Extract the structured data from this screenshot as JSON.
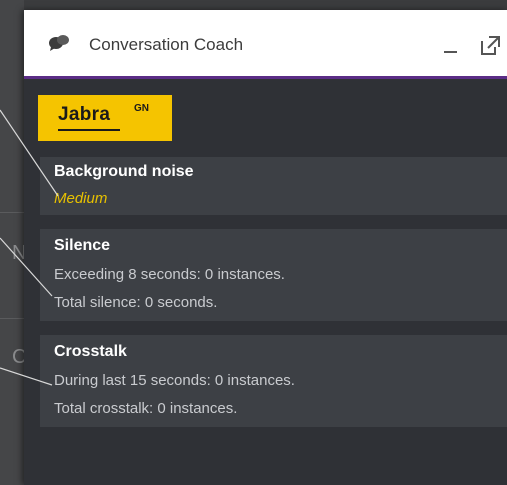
{
  "window": {
    "title": "Conversation Coach"
  },
  "logo": {
    "brand": "Jabra",
    "superscript": "GN"
  },
  "background_letters": [
    "N",
    "C"
  ],
  "cards": {
    "background_noise": {
      "title": "Background noise",
      "value": "Medium"
    },
    "silence": {
      "title": "Silence",
      "line1": "Exceeding 8 seconds: 0 instances.",
      "line2": "Total silence: 0 seconds."
    },
    "crosstalk": {
      "title": "Crosstalk",
      "line1": "During last 15 seconds: 0 instances.",
      "line2": "Total crosstalk: 0 instances."
    }
  },
  "colors": {
    "accent": "#5b2d86",
    "logo_bg": "#f5c400",
    "highlight": "#e8c100"
  }
}
